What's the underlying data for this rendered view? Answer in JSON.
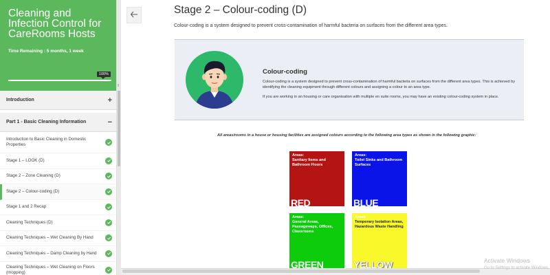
{
  "sidebar": {
    "course_title": "Cleaning and Infection Control for CareRooms Hosts",
    "time_remaining": "Time Remaining : 5 months, 1 week",
    "progress_percent": 100,
    "progress_label": "100%",
    "sections": [
      {
        "label": "Introduction",
        "toggle": "+"
      },
      {
        "label": "Part 1 - Basic Cleaning Information",
        "toggle": "−"
      }
    ],
    "items": [
      {
        "label": "Introduction to Basic Cleaning in Domestic Properties",
        "completed": true
      },
      {
        "label": "Stage 1 – LOOK (D)",
        "completed": true
      },
      {
        "label": "Stage 2 – Zone Cleaning (D)",
        "completed": true
      },
      {
        "label": "Stage 2 – Colour-coding (D)",
        "completed": true,
        "active": true
      },
      {
        "label": "Stage 1 and 2 Recap",
        "completed": true
      },
      {
        "label": "Cleaning Techniques (D)",
        "completed": true
      },
      {
        "label": "Cleaning Techniques – Wet Cleaning By Hand",
        "completed": true
      },
      {
        "label": "Cleaning Techniques – Damp Cleaning by Hand",
        "completed": true
      },
      {
        "label": "Cleaning Techniques – Wet Cleaning on Floors (mopping)",
        "completed": true
      }
    ]
  },
  "main": {
    "back_icon": "back-arrow-icon",
    "title": "Stage 2 – Colour-coding (D)",
    "intro": "Colour-coding is a system designed to prevent cross-contamination of harmful bacteria on surfaces from the different area types.",
    "box": {
      "heading": "Colour-coding",
      "paragraph1": "Colour-coding is a system designed to prevent cross-contamination of harmful bacteria on surfaces from the different area types. This is achieved by identifying the cleaning equipment through different colours and assigning a colour to an area type.",
      "paragraph2": "If you are working in an housing or care organisation with multiple en suite rooms, you may have an existing colour-coding system in place."
    },
    "caption": "All areas/rooms in a house or housing facilities are assigned colours according to the following area types as shown in the following graphic:",
    "swatches": {
      "red": {
        "areas_label": "Areas:",
        "areas": "Sanitary Items and Bathroom Floors",
        "word": "RED",
        "color": "#b51414"
      },
      "blue": {
        "areas_label": "Areas:",
        "areas": "Toilet Sinks and Bathroom Surfaces",
        "word": "BLUE",
        "color": "#0a14e8"
      },
      "green": {
        "areas_label": "Areas:",
        "areas": "General Areas, Passageways, Offices, Classrooms",
        "word": "GREEN",
        "color": "#0ccc0c"
      },
      "yellow": {
        "areas_label": "Areas:",
        "areas": "Temporary Isolation Areas, Hazardous Waste Handling",
        "word": "YELLOW",
        "color": "#f8f82a"
      }
    }
  },
  "os": {
    "watermark_title": "Activate Windows",
    "watermark_sub": "Go to Settings to activate Windows."
  },
  "colors": {
    "accent": "#5cb85c",
    "box_bg": "#eceef6"
  }
}
